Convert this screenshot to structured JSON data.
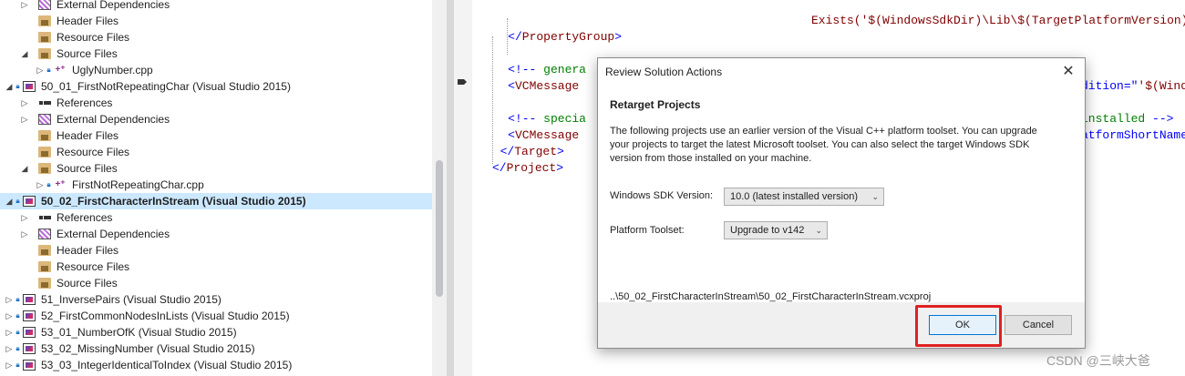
{
  "explorer": {
    "rows": [
      {
        "expander": "▷",
        "lock": false,
        "icon": "ext",
        "icon_name": "external-dependencies-icon",
        "label": "External Dependencies",
        "indent": 1
      },
      {
        "expander": "",
        "lock": false,
        "icon": "folder",
        "icon_name": "filter-folder-icon",
        "label": "Header Files",
        "indent": 1
      },
      {
        "expander": "",
        "lock": false,
        "icon": "folder",
        "icon_name": "filter-folder-icon",
        "label": "Resource Files",
        "indent": 1
      },
      {
        "expander": "◢",
        "lock": false,
        "icon": "folder",
        "icon_name": "filter-folder-icon",
        "label": "Source Files",
        "indent": 1
      },
      {
        "expander": "▷",
        "lock": true,
        "icon": "cpp",
        "icon_name": "cpp-file-icon",
        "label": "UglyNumber.cpp",
        "indent": 2
      },
      {
        "expander": "◢",
        "lock": true,
        "icon": "proj",
        "icon_name": "vc-project-icon",
        "label": "50_01_FirstNotRepeatingChar (Visual Studio 2015)",
        "indent": 0
      },
      {
        "expander": "▷",
        "lock": false,
        "icon": "refs",
        "icon_name": "references-icon",
        "label": "References",
        "indent": 1
      },
      {
        "expander": "▷",
        "lock": false,
        "icon": "ext",
        "icon_name": "external-dependencies-icon",
        "label": "External Dependencies",
        "indent": 1
      },
      {
        "expander": "",
        "lock": false,
        "icon": "folder",
        "icon_name": "filter-folder-icon",
        "label": "Header Files",
        "indent": 1
      },
      {
        "expander": "",
        "lock": false,
        "icon": "folder",
        "icon_name": "filter-folder-icon",
        "label": "Resource Files",
        "indent": 1
      },
      {
        "expander": "◢",
        "lock": false,
        "icon": "folder",
        "icon_name": "filter-folder-icon",
        "label": "Source Files",
        "indent": 1
      },
      {
        "expander": "▷",
        "lock": true,
        "icon": "cpp",
        "icon_name": "cpp-file-icon",
        "label": "FirstNotRepeatingChar.cpp",
        "indent": 2
      },
      {
        "expander": "◢",
        "lock": true,
        "icon": "proj",
        "icon_name": "vc-project-icon",
        "label": "50_02_FirstCharacterInStream (Visual Studio 2015)",
        "indent": 0,
        "selected": true
      },
      {
        "expander": "▷",
        "lock": false,
        "icon": "refs",
        "icon_name": "references-icon",
        "label": "References",
        "indent": 1
      },
      {
        "expander": "▷",
        "lock": false,
        "icon": "ext",
        "icon_name": "external-dependencies-icon",
        "label": "External Dependencies",
        "indent": 1
      },
      {
        "expander": "",
        "lock": false,
        "icon": "folder",
        "icon_name": "filter-folder-icon",
        "label": "Header Files",
        "indent": 1
      },
      {
        "expander": "",
        "lock": false,
        "icon": "folder",
        "icon_name": "filter-folder-icon",
        "label": "Resource Files",
        "indent": 1
      },
      {
        "expander": "",
        "lock": false,
        "icon": "folder",
        "icon_name": "filter-folder-icon",
        "label": "Source Files",
        "indent": 1
      },
      {
        "expander": "▷",
        "lock": true,
        "icon": "proj",
        "icon_name": "vc-project-icon",
        "label": "51_InversePairs (Visual Studio 2015)",
        "indent": 0
      },
      {
        "expander": "▷",
        "lock": true,
        "icon": "proj",
        "icon_name": "vc-project-icon",
        "label": "52_FirstCommonNodesInLists (Visual Studio 2015)",
        "indent": 0
      },
      {
        "expander": "▷",
        "lock": true,
        "icon": "proj",
        "icon_name": "vc-project-icon",
        "label": "53_01_NumberOfK (Visual Studio 2015)",
        "indent": 0
      },
      {
        "expander": "▷",
        "lock": true,
        "icon": "proj",
        "icon_name": "vc-project-icon",
        "label": "53_02_MissingNumber (Visual Studio 2015)",
        "indent": 0
      },
      {
        "expander": "▷",
        "lock": true,
        "icon": "proj",
        "icon_name": "vc-project-icon",
        "label": "53_03_IntegerIdenticalToIndex (Visual Studio 2015)",
        "indent": 0
      }
    ]
  },
  "editor": {
    "lines": [
      {
        "indent": "",
        "parts": []
      },
      {
        "indent": "",
        "parts": [
          {
            "c": "tag",
            "t": "Exists('$(WindowsSdkDir)\\Lib\\$(TargetPlatformVersion)"
          }
        ],
        "col": "far"
      },
      {
        "indent": "    ",
        "parts": [
          {
            "c": "br",
            "t": "</"
          },
          {
            "c": "tag",
            "t": "PropertyGroup"
          },
          {
            "c": "br",
            "t": ">"
          }
        ]
      },
      {
        "indent": "",
        "parts": []
      },
      {
        "indent": "    ",
        "parts": [
          {
            "c": "br",
            "t": "<!-- "
          },
          {
            "c": "cm",
            "t": "genera"
          }
        ]
      },
      {
        "indent": "    ",
        "parts": [
          {
            "c": "br",
            "t": "<"
          },
          {
            "c": "tag",
            "t": "VCMessage"
          }
        ]
      },
      {
        "indent": "",
        "parts": []
      },
      {
        "indent": "    ",
        "parts": [
          {
            "c": "br",
            "t": "<!-- "
          },
          {
            "c": "cm",
            "t": "specia"
          }
        ]
      },
      {
        "indent": "    ",
        "parts": [
          {
            "c": "br",
            "t": "<"
          },
          {
            "c": "tag",
            "t": "VCMessage"
          }
        ]
      },
      {
        "indent": "  ",
        "parts": [
          {
            "c": "br",
            "t": "</"
          },
          {
            "c": "tag",
            "t": "Target"
          },
          {
            "c": "br",
            "t": ">"
          }
        ]
      },
      {
        "indent": "",
        "parts": [
          {
            "c": "br",
            "t": "</"
          },
          {
            "c": "tag",
            "t": "Project"
          },
          {
            "c": "br",
            "t": ">"
          }
        ]
      }
    ],
    "right_fragments": [
      {
        "line": 5,
        "parts": [
          {
            "c": "at",
            "t": "dition"
          },
          {
            "c": "br",
            "t": "=\""
          },
          {
            "c": "tag",
            "t": "'$(Wind"
          }
        ]
      },
      {
        "line": 7,
        "parts": [
          {
            "c": "cm",
            "t": "installed "
          },
          {
            "c": "br",
            "t": "-->"
          }
        ]
      },
      {
        "line": 8,
        "parts": [
          {
            "c": "at",
            "t": "atformShortName"
          }
        ]
      }
    ]
  },
  "dialog": {
    "title": "Review Solution Actions",
    "close_glyph": "✕",
    "heading": "Retarget Projects",
    "description": "The following projects use an earlier version of the Visual C++ platform toolset.  You can upgrade your projects to target the latest Microsoft toolset.  You can also select the target Windows SDK version from those installed on your machine.",
    "sdk_label": "Windows SDK Version:",
    "sdk_value": "10.0 (latest installed version)",
    "toolset_label": "Platform Toolset:",
    "toolset_value": "Upgrade to v142",
    "project_path": "..\\50_02_FirstCharacterInStream\\50_02_FirstCharacterInStream.vcxproj",
    "ok_label": "OK",
    "cancel_label": "Cancel",
    "chevron_glyph": "⌄"
  },
  "watermark": "CSDN @三峡大爸",
  "colors": {
    "selection": "#cce8ff",
    "highlight_box": "#e02020",
    "xml_tag": "#800000",
    "xml_bracket": "#0000ff",
    "xml_comment": "#008000"
  }
}
